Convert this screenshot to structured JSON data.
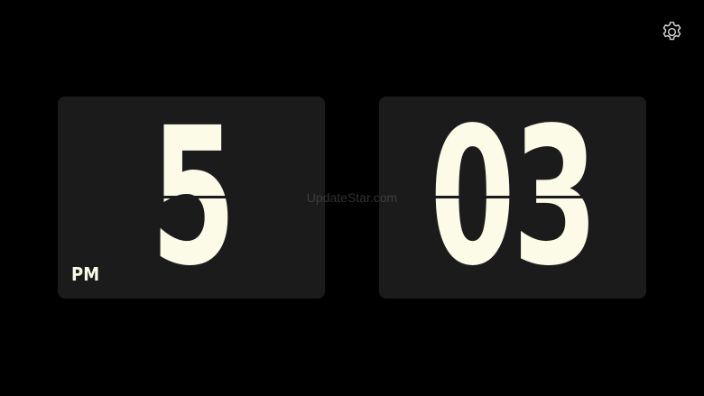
{
  "clock": {
    "hours": "5",
    "minutes": "03",
    "meridiem": "PM"
  },
  "watermark": {
    "text": "UpdateStar.com"
  },
  "icons": {
    "settings": "gear-icon"
  },
  "colors": {
    "background": "#000000",
    "card": "#1b1b1b",
    "digit": "#fbfbe8",
    "icon": "#d6d6d6"
  }
}
